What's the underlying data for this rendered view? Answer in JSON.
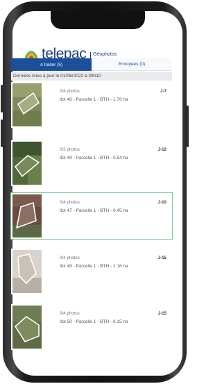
{
  "app": {
    "logo_text": "telepac",
    "logo_subtitle": "Géophotos"
  },
  "tabs": [
    {
      "label": "A traiter (5)",
      "active": true
    },
    {
      "label": "Envoyées (0)",
      "active": false
    }
  ],
  "update_text": "Dernière mise à jour le 01/06/2022 à 09h10",
  "items": [
    {
      "photos": "0/4 photos",
      "plot": "Ilot 46 - Parcelle 1 - BTH - 1.76 ha",
      "days": "J-7",
      "selected": false
    },
    {
      "photos": "0/2 photos",
      "plot": "Ilot 49 - Parcelle 1 - BTH - 0.54 ha",
      "days": "J-12",
      "selected": false
    },
    {
      "photos": "0/4 photos",
      "plot": "Ilot 47 - Parcelle 1 - BTH - 0.45 ha",
      "days": "J-10",
      "selected": true
    },
    {
      "photos": "0/4 photos",
      "plot": "Ilot 48 - Parcelle 1 - BTH - 2.16 ha",
      "days": "J-15",
      "selected": false
    },
    {
      "photos": "0/4 photos",
      "plot": "Ilot 50 - Parcelle 1 - BTH - 6.15 ha",
      "days": "J-15",
      "selected": false
    }
  ],
  "colors": {
    "brand_blue": "#1b4f9c",
    "selected_border": "#7fc99a",
    "logo_green": "#6cb33f"
  }
}
